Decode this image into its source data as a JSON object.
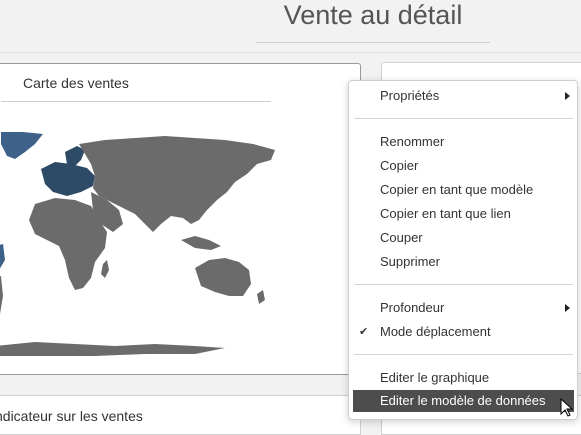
{
  "page": {
    "title": "Vente au détail"
  },
  "map_panel": {
    "title": "Carte des ventes"
  },
  "bottom_panel": {
    "title": "ndicateur sur les ventes"
  },
  "colors": {
    "land": "#6b6b6b",
    "highlight": "#2d4a66",
    "highlight_light": "#3e6189",
    "menu_active_bg": "#4d4d4d"
  },
  "context_menu": {
    "items": [
      {
        "label": "Propriétés",
        "submenu": true
      },
      {
        "label": "Renommer"
      },
      {
        "label": "Copier"
      },
      {
        "label": "Copier en tant que modèle"
      },
      {
        "label": "Copier en tant que lien"
      },
      {
        "label": "Couper"
      },
      {
        "label": "Supprimer"
      },
      {
        "label": "Profondeur",
        "submenu": true
      },
      {
        "label": "Mode déplacement",
        "checked": true
      },
      {
        "label": "Editer le graphique"
      },
      {
        "label": "Editer le modèle de données",
        "active": true
      }
    ]
  }
}
